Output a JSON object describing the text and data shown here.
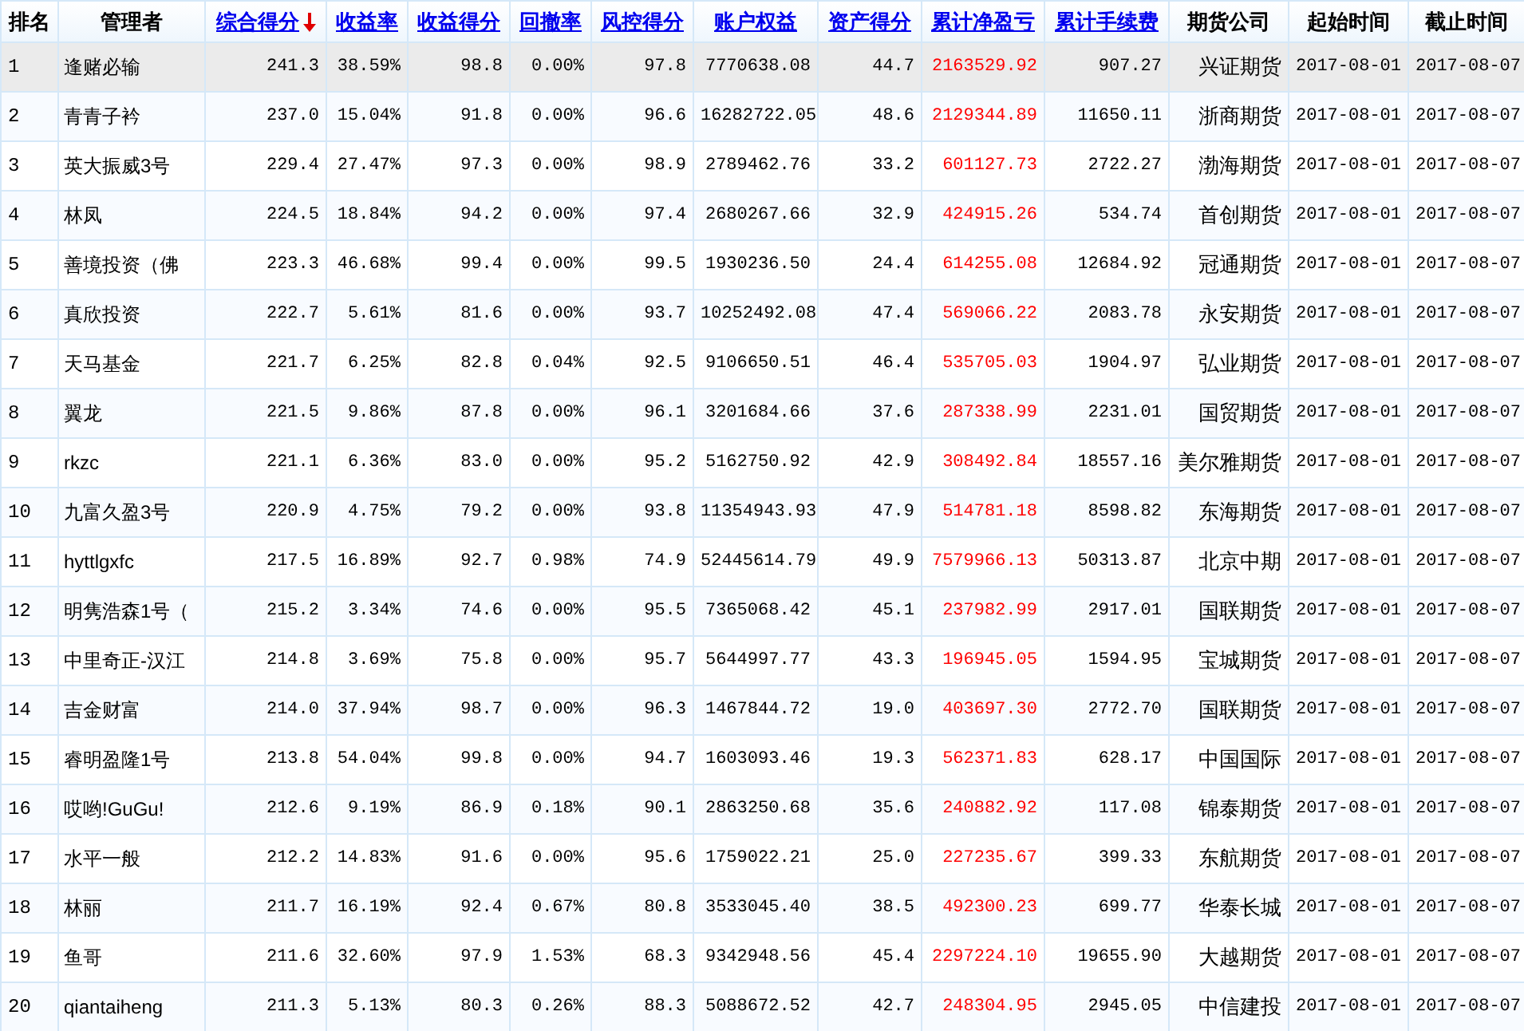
{
  "table": {
    "columns": [
      {
        "label": "排名",
        "sortable": false,
        "kind": "rank"
      },
      {
        "label": "管理者",
        "sortable": false,
        "kind": "name"
      },
      {
        "label": "综合得分",
        "sortable": true,
        "sorted": true,
        "kind": "number"
      },
      {
        "label": "收益率",
        "sortable": true,
        "sorted": false,
        "kind": "number"
      },
      {
        "label": "收益得分",
        "sortable": true,
        "sorted": false,
        "kind": "number"
      },
      {
        "label": "回撤率",
        "sortable": true,
        "sorted": false,
        "kind": "number"
      },
      {
        "label": "风控得分",
        "sortable": true,
        "sorted": false,
        "kind": "number"
      },
      {
        "label": "账户权益",
        "sortable": true,
        "sorted": false,
        "kind": "number"
      },
      {
        "label": "资产得分",
        "sortable": true,
        "sorted": false,
        "kind": "number"
      },
      {
        "label": "累计净盈亏",
        "sortable": true,
        "sorted": false,
        "kind": "profit"
      },
      {
        "label": "累计手续费",
        "sortable": true,
        "sorted": false,
        "kind": "number"
      },
      {
        "label": "期货公司",
        "sortable": false,
        "kind": "company"
      },
      {
        "label": "起始时间",
        "sortable": false,
        "kind": "date"
      },
      {
        "label": "截止时间",
        "sortable": false,
        "kind": "date"
      }
    ],
    "rows": [
      {
        "selected": true,
        "cells": [
          "1",
          "逢赌必输",
          "241.3",
          "38.59%",
          "98.8",
          "0.00%",
          "97.8",
          "7770638.08",
          "44.7",
          "2163529.92",
          "907.27",
          "兴证期货",
          "2017-08-01",
          "2017-08-07"
        ]
      },
      {
        "selected": false,
        "cells": [
          "2",
          "青青子衿",
          "237.0",
          "15.04%",
          "91.8",
          "0.00%",
          "96.6",
          "16282722.05",
          "48.6",
          "2129344.89",
          "11650.11",
          "浙商期货",
          "2017-08-01",
          "2017-08-07"
        ]
      },
      {
        "selected": false,
        "cells": [
          "3",
          "英大振威3号",
          "229.4",
          "27.47%",
          "97.3",
          "0.00%",
          "98.9",
          "2789462.76",
          "33.2",
          "601127.73",
          "2722.27",
          "渤海期货",
          "2017-08-01",
          "2017-08-07"
        ]
      },
      {
        "selected": false,
        "cells": [
          "4",
          "林凤",
          "224.5",
          "18.84%",
          "94.2",
          "0.00%",
          "97.4",
          "2680267.66",
          "32.9",
          "424915.26",
          "534.74",
          "首创期货",
          "2017-08-01",
          "2017-08-07"
        ]
      },
      {
        "selected": false,
        "cells": [
          "5",
          "善境投资（佛",
          "223.3",
          "46.68%",
          "99.4",
          "0.00%",
          "99.5",
          "1930236.50",
          "24.4",
          "614255.08",
          "12684.92",
          "冠通期货",
          "2017-08-01",
          "2017-08-07"
        ]
      },
      {
        "selected": false,
        "cells": [
          "6",
          "真欣投资",
          "222.7",
          "5.61%",
          "81.6",
          "0.00%",
          "93.7",
          "10252492.08",
          "47.4",
          "569066.22",
          "2083.78",
          "永安期货",
          "2017-08-01",
          "2017-08-07"
        ]
      },
      {
        "selected": false,
        "cells": [
          "7",
          "天马基金",
          "221.7",
          "6.25%",
          "82.8",
          "0.04%",
          "92.5",
          "9106650.51",
          "46.4",
          "535705.03",
          "1904.97",
          "弘业期货",
          "2017-08-01",
          "2017-08-07"
        ]
      },
      {
        "selected": false,
        "cells": [
          "8",
          "翼龙",
          "221.5",
          "9.86%",
          "87.8",
          "0.00%",
          "96.1",
          "3201684.66",
          "37.6",
          "287338.99",
          "2231.01",
          "国贸期货",
          "2017-08-01",
          "2017-08-07"
        ]
      },
      {
        "selected": false,
        "cells": [
          "9",
          "rkzc",
          "221.1",
          "6.36%",
          "83.0",
          "0.00%",
          "95.2",
          "5162750.92",
          "42.9",
          "308492.84",
          "18557.16",
          "美尔雅期货",
          "2017-08-01",
          "2017-08-07"
        ]
      },
      {
        "selected": false,
        "cells": [
          "10",
          "九富久盈3号",
          "220.9",
          "4.75%",
          "79.2",
          "0.00%",
          "93.8",
          "11354943.93",
          "47.9",
          "514781.18",
          "8598.82",
          "东海期货",
          "2017-08-01",
          "2017-08-07"
        ]
      },
      {
        "selected": false,
        "cells": [
          "11",
          "hyttlgxfc",
          "217.5",
          "16.89%",
          "92.7",
          "0.98%",
          "74.9",
          "52445614.79",
          "49.9",
          "7579966.13",
          "50313.87",
          "北京中期",
          "2017-08-01",
          "2017-08-07"
        ]
      },
      {
        "selected": false,
        "cells": [
          "12",
          "明隽浩森1号（",
          "215.2",
          "3.34%",
          "74.6",
          "0.00%",
          "95.5",
          "7365068.42",
          "45.1",
          "237982.99",
          "2917.01",
          "国联期货",
          "2017-08-01",
          "2017-08-07"
        ]
      },
      {
        "selected": false,
        "cells": [
          "13",
          "中里奇正-汉江",
          "214.8",
          "3.69%",
          "75.8",
          "0.00%",
          "95.7",
          "5644997.77",
          "43.3",
          "196945.05",
          "1594.95",
          "宝城期货",
          "2017-08-01",
          "2017-08-07"
        ]
      },
      {
        "selected": false,
        "cells": [
          "14",
          "吉金财富",
          "214.0",
          "37.94%",
          "98.7",
          "0.00%",
          "96.3",
          "1467844.72",
          "19.0",
          "403697.30",
          "2772.70",
          "国联期货",
          "2017-08-01",
          "2017-08-07"
        ]
      },
      {
        "selected": false,
        "cells": [
          "15",
          "睿明盈隆1号",
          "213.8",
          "54.04%",
          "99.8",
          "0.00%",
          "94.7",
          "1603093.46",
          "19.3",
          "562371.83",
          "628.17",
          "中国国际",
          "2017-08-01",
          "2017-08-07"
        ]
      },
      {
        "selected": false,
        "cells": [
          "16",
          "哎哟!GuGu!",
          "212.6",
          "9.19%",
          "86.9",
          "0.18%",
          "90.1",
          "2863250.68",
          "35.6",
          "240882.92",
          "117.08",
          "锦泰期货",
          "2017-08-01",
          "2017-08-07"
        ]
      },
      {
        "selected": false,
        "cells": [
          "17",
          "水平一般",
          "212.2",
          "14.83%",
          "91.6",
          "0.00%",
          "95.6",
          "1759022.21",
          "25.0",
          "227235.67",
          "399.33",
          "东航期货",
          "2017-08-01",
          "2017-08-07"
        ]
      },
      {
        "selected": false,
        "cells": [
          "18",
          "林丽",
          "211.7",
          "16.19%",
          "92.4",
          "0.67%",
          "80.8",
          "3533045.40",
          "38.5",
          "492300.23",
          "699.77",
          "华泰长城",
          "2017-08-01",
          "2017-08-07"
        ]
      },
      {
        "selected": false,
        "cells": [
          "19",
          "鱼哥",
          "211.6",
          "32.60%",
          "97.9",
          "1.53%",
          "68.3",
          "9342948.56",
          "45.4",
          "2297224.10",
          "19655.90",
          "大越期货",
          "2017-08-01",
          "2017-08-07"
        ]
      },
      {
        "selected": false,
        "cells": [
          "20",
          "qiantaiheng",
          "211.3",
          "5.13%",
          "80.3",
          "0.26%",
          "88.3",
          "5088672.52",
          "42.7",
          "248304.95",
          "2945.05",
          "中信建投",
          "2017-08-01",
          "2017-08-07"
        ]
      }
    ]
  }
}
